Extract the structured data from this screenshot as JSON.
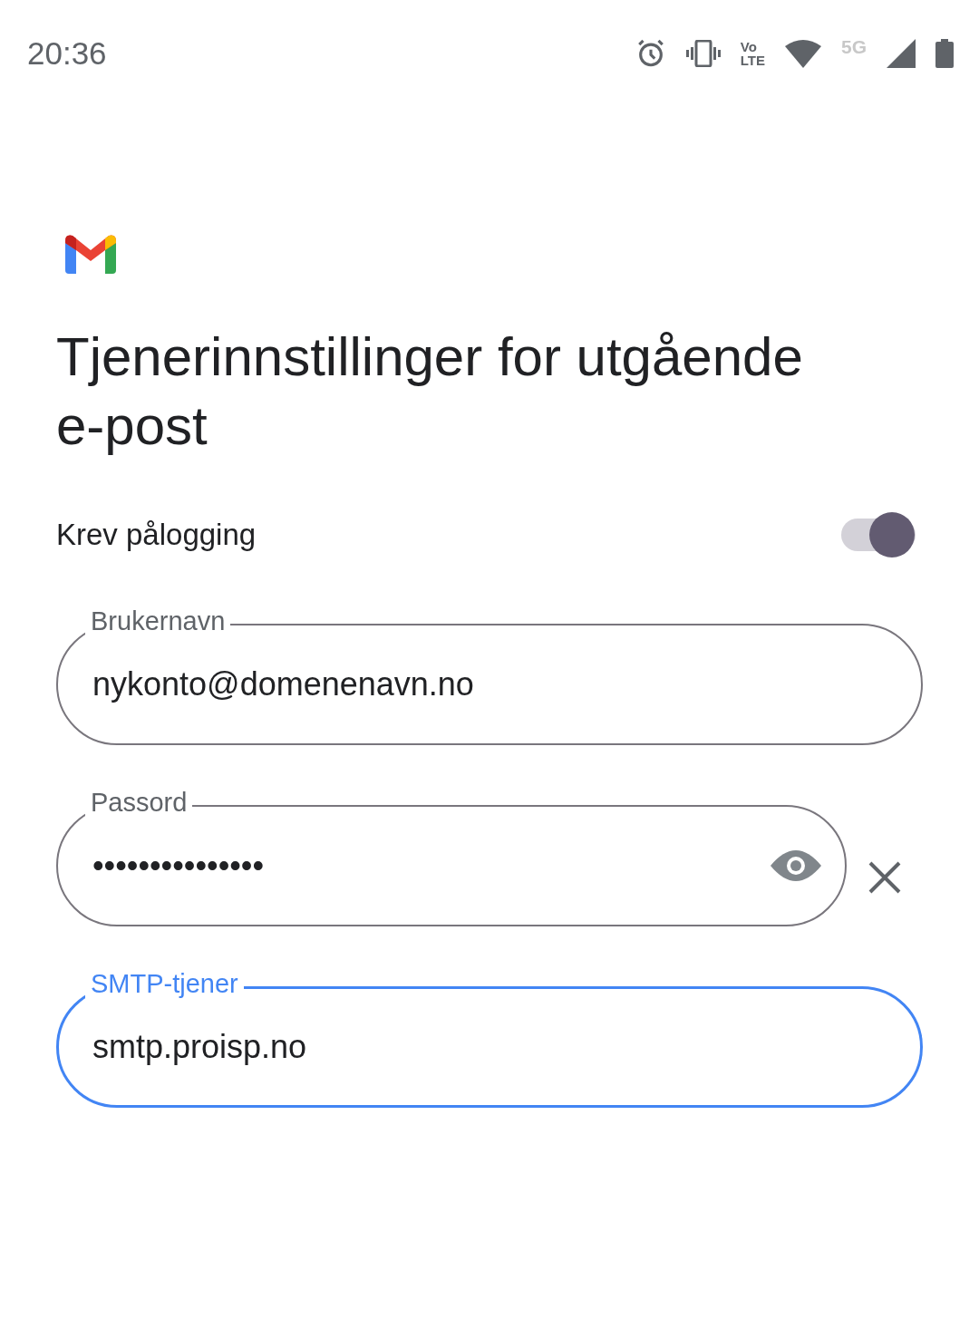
{
  "status_bar": {
    "time": "20:36",
    "volte": [
      "Vo",
      "LTE"
    ],
    "network": "5G"
  },
  "title": "Tjenerinnstillinger for utgående e-post",
  "require_login": {
    "label": "Krev pålogging",
    "on": true
  },
  "fields": [
    {
      "label": "Brukernavn",
      "value": "nykonto@domenenavn.no",
      "focused": false,
      "show_toggle": false,
      "clear_button": false
    },
    {
      "label": "Passord",
      "value": "•••••••••••••••",
      "focused": false,
      "show_toggle": true,
      "clear_button": true
    },
    {
      "label": "SMTP-tjener",
      "value": "smtp.proisp.no",
      "focused": true,
      "show_toggle": false,
      "clear_button": false
    }
  ]
}
